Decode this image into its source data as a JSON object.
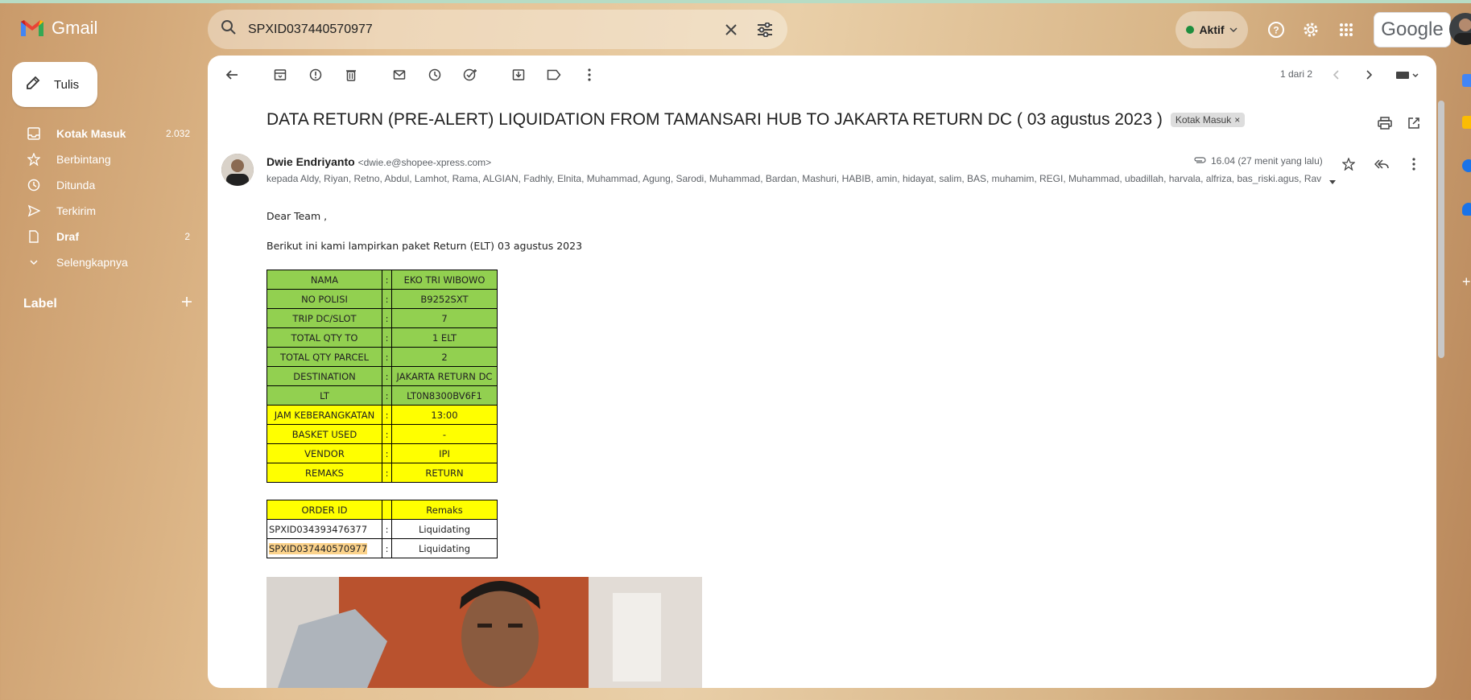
{
  "app": {
    "name": "Gmail"
  },
  "search": {
    "query": "SPXID037440570977"
  },
  "header": {
    "status_label": "Aktif",
    "account_brand": "Google"
  },
  "sidebar": {
    "compose_label": "Tulis",
    "items": [
      {
        "label": "Kotak Masuk",
        "count": "2.032",
        "bold": true,
        "icon": "inbox-icon"
      },
      {
        "label": "Berbintang",
        "count": "",
        "bold": false,
        "icon": "star-icon"
      },
      {
        "label": "Ditunda",
        "count": "",
        "bold": false,
        "icon": "clock-icon"
      },
      {
        "label": "Terkirim",
        "count": "",
        "bold": false,
        "icon": "send-icon"
      },
      {
        "label": "Draf",
        "count": "2",
        "bold": true,
        "icon": "draft-icon"
      },
      {
        "label": "Selengkapnya",
        "count": "",
        "bold": false,
        "icon": "chevron-down-icon"
      }
    ],
    "labels_heading": "Label"
  },
  "toolbar": {
    "pager": "1 dari 2"
  },
  "email": {
    "subject": "DATA RETURN (PRE-ALERT) LIQUIDATION FROM TAMANSARI HUB TO JAKARTA RETURN DC ( 03 agustus 2023 )",
    "label_chip": "Kotak Masuk",
    "sender_name": "Dwie Endriyanto",
    "sender_email": "<dwie.e@shopee-xpress.com>",
    "recipients": "kepada Aldy, Riyan, Retno, Abdul, Lamhot, Rama, ALGIAN, Fadhly, Elnita, Muhammad, Agung, Sarodi, Muhammad, Bardan, Mashuri, HABIB, amin, hidayat, salim, BAS, muhamim, REGI, Muhammad, ubadillah, harvala, alfriza, bas_riski.agus, Ravi, G",
    "time": "16.04 (27 menit yang lalu)",
    "greeting": "Dear Team ,",
    "intro": "Berikut ini kami lampirkan paket Return (ELT) 03 agustus  2023",
    "info_table": [
      {
        "key": "NAMA",
        "sep": ":",
        "value": "EKO TRI WIBOWO",
        "color": "green"
      },
      {
        "key": "NO POLISI",
        "sep": ":",
        "value": "B9252SXT",
        "color": "green"
      },
      {
        "key": "TRIP DC/SLOT",
        "sep": ":",
        "value": "7",
        "color": "green"
      },
      {
        "key": "TOTAL QTY TO",
        "sep": ":",
        "value": "1 ELT",
        "color": "green"
      },
      {
        "key": "TOTAL QTY PARCEL",
        "sep": ":",
        "value": "2",
        "color": "green"
      },
      {
        "key": "DESTINATION",
        "sep": ":",
        "value": "JAKARTA RETURN DC",
        "color": "green"
      },
      {
        "key": "LT",
        "sep": ":",
        "value": "LT0N8300BV6F1",
        "color": "green"
      },
      {
        "key": "JAM KEBERANGKATAN",
        "sep": ":",
        "value": "13:00",
        "color": "yellow"
      },
      {
        "key": "BASKET USED",
        "sep": ":",
        "value": "-",
        "color": "yellow"
      },
      {
        "key": "VENDOR",
        "sep": ":",
        "value": "IPI",
        "color": "yellow"
      },
      {
        "key": "REMAKS",
        "sep": ":",
        "value": "RETURN",
        "color": "yellow"
      }
    ],
    "order_table": {
      "headers": [
        "ORDER ID",
        "",
        "Remaks"
      ],
      "rows": [
        {
          "id": "SPXID034393476377",
          "sep": ":",
          "remark": "Liquidating",
          "highlight": false
        },
        {
          "id": "SPXID037440570977",
          "sep": ":",
          "remark": "Liquidating",
          "highlight": true
        }
      ]
    }
  }
}
